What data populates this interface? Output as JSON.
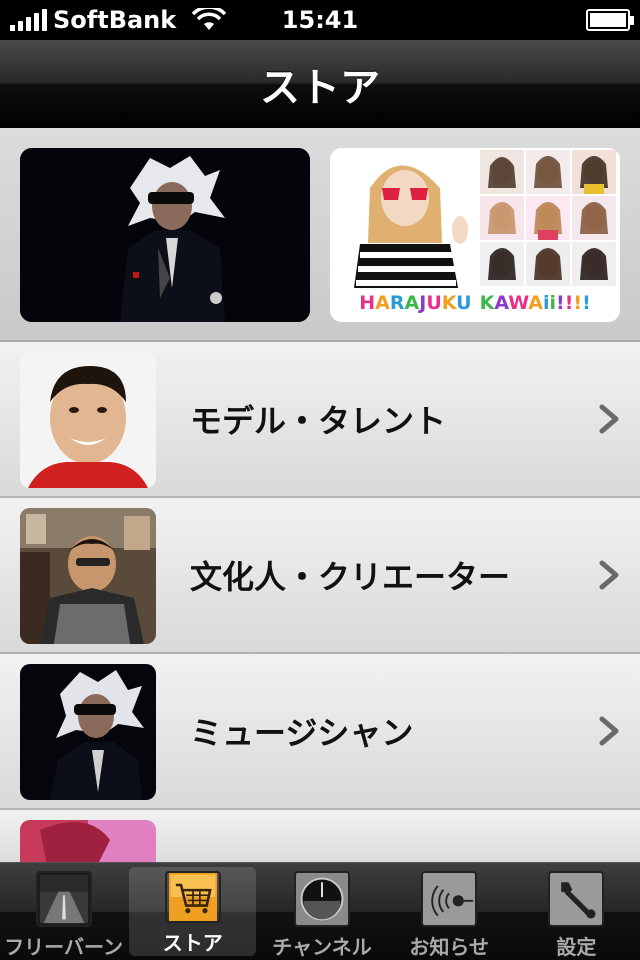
{
  "status_bar": {
    "carrier": "SoftBank",
    "time": "15:41",
    "battery_level": 1.0
  },
  "navbar": {
    "title": "ストア"
  },
  "banners": [
    {
      "name": "banner-musician",
      "logo_text": ""
    },
    {
      "name": "banner-harajuku-kawaii",
      "logo_text": "HARAJUKU KAWAii!!!!"
    }
  ],
  "list": {
    "items": [
      {
        "label": "モデル・タレント"
      },
      {
        "label": "文化人・クリエーター"
      },
      {
        "label": "ミュージシャン"
      }
    ]
  },
  "tabbar": {
    "tabs": [
      {
        "label": "フリーバーン",
        "icon": "road-icon"
      },
      {
        "label": "ストア",
        "icon": "cart-icon",
        "selected": true
      },
      {
        "label": "チャンネル",
        "icon": "dial-icon"
      },
      {
        "label": "お知らせ",
        "icon": "broadcast-icon"
      },
      {
        "label": "設定",
        "icon": "wrench-icon"
      }
    ]
  },
  "colors": {
    "navbar": "#000000",
    "selected_tab_icon": "#f0a020",
    "logo_letters": [
      "#e8308a",
      "#f0a020",
      "#2a9ad8",
      "#3cb84a",
      "#8a3cc8"
    ]
  }
}
